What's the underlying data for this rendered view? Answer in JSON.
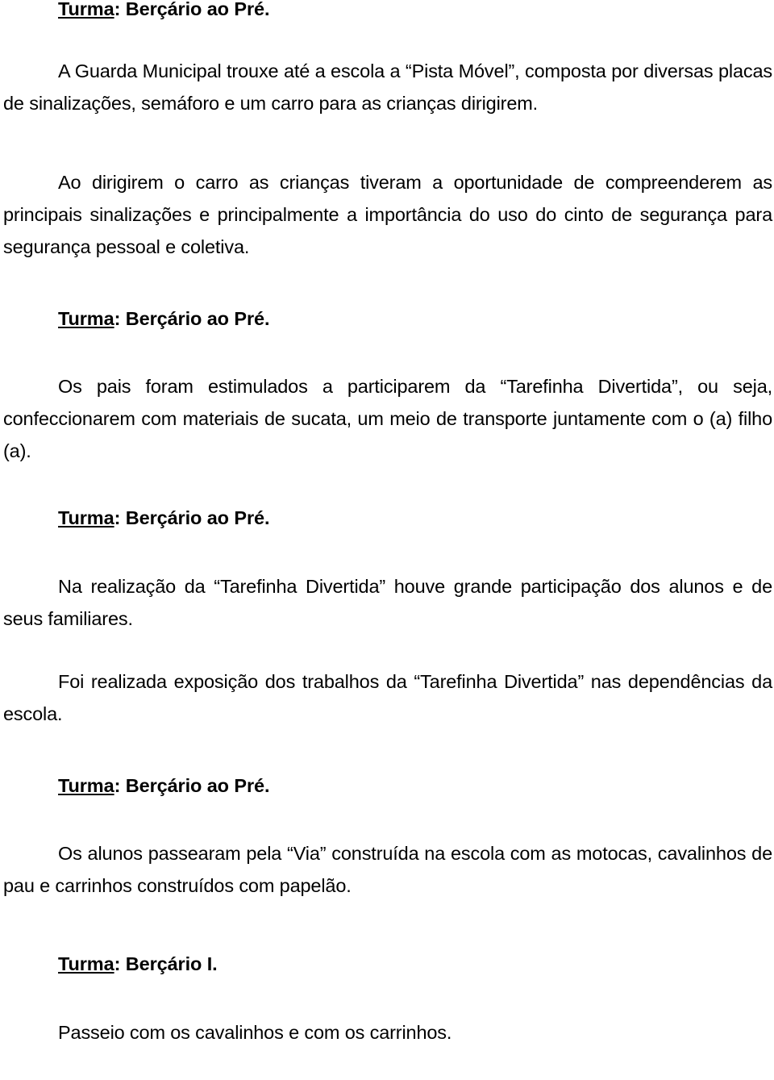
{
  "document": {
    "language": "pt-BR",
    "text_color": "#000000",
    "background_color": "#ffffff",
    "sections": [
      {
        "heading_label": "Turma",
        "heading_separator": ": ",
        "heading_value": "Berçário ao Pré.",
        "paragraphs": [
          "A Guarda Municipal trouxe até a escola a “Pista Móvel”, composta por diversas placas de sinalizações, semáforo e um carro para as crianças dirigirem.",
          "Ao dirigirem o carro as crianças tiveram a oportunidade de compreenderem as principais sinalizações e principalmente a importância do uso do cinto de segurança para segurança pessoal e coletiva."
        ]
      },
      {
        "heading_label": "Turma",
        "heading_separator": ": ",
        "heading_value": "Berçário ao Pré.",
        "paragraphs": [
          "Os pais foram estimulados a participarem da “Tarefinha Divertida”, ou seja, confeccionarem com materiais de sucata, um meio de transporte juntamente com o (a) filho (a)."
        ]
      },
      {
        "heading_label": "Turma",
        "heading_separator": ": ",
        "heading_value": "Berçário ao Pré.",
        "paragraphs": [
          "Na realização da “Tarefinha Divertida” houve grande participação dos alunos e de seus familiares.",
          "Foi realizada exposição dos trabalhos da “Tarefinha Divertida” nas dependências da escola."
        ]
      },
      {
        "heading_label": "Turma",
        "heading_separator": ": ",
        "heading_value": "Berçário ao Pré.",
        "paragraphs": [
          "Os alunos passearam pela “Via” construída na escola com as motocas, cavalinhos de pau e carrinhos construídos com papelão."
        ]
      },
      {
        "heading_label": "Turma",
        "heading_separator": ": ",
        "heading_value": "Berçário I.",
        "paragraphs": [
          "Passeio com os cavalinhos e com os carrinhos."
        ]
      }
    ]
  }
}
